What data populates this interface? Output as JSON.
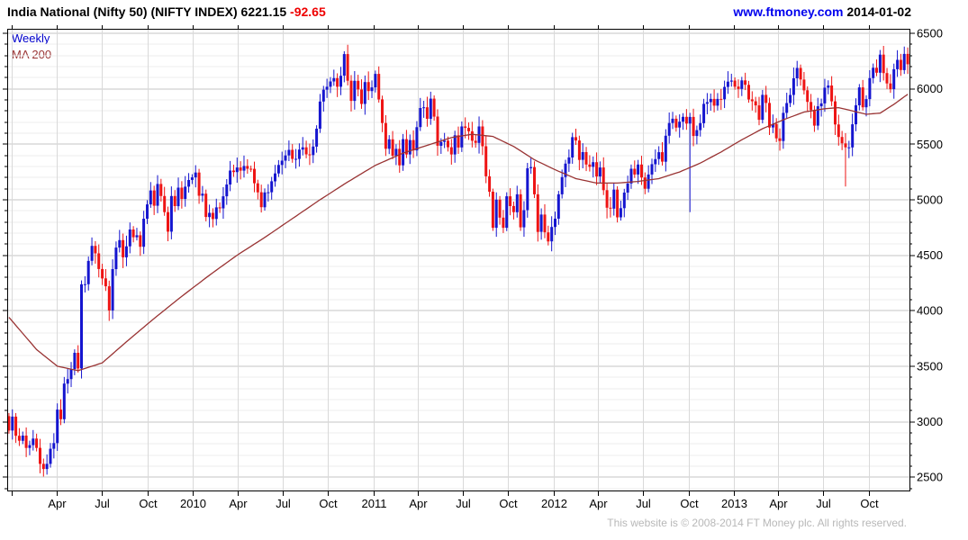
{
  "header": {
    "title": "India National (Nifty 50) (NIFTY INDEX) 6221.15",
    "change": "-92.65",
    "site": "www.ftmoney.com",
    "date": "2014-01-02"
  },
  "legend": {
    "series_label": "Weekly",
    "ma_label": "MA 200"
  },
  "footer": {
    "copyright": "This website is © 2008-2014 FT Money plc. All rights reserved."
  },
  "colors": {
    "up": "#1515cf",
    "down": "#ee1414",
    "ma": "#993333",
    "grid_minor": "#ececec",
    "grid_major": "#c6c6c6",
    "grid_vertical": "#d9d9d9",
    "axis": "#000000",
    "change_text": "#ee0000",
    "link": "#0000ee",
    "legend_series": "#0000cc",
    "legend_ma": "#993333",
    "footer_text": "#b8b8b8"
  },
  "chart_data": {
    "type": "candlestick",
    "title": "India National (Nifty 50) (NIFTY INDEX)",
    "timeframe": "Weekly",
    "overlay": "MA 200",
    "last_price": 6221.15,
    "change": -92.65,
    "date": "2014-01-02",
    "ylim": [
      2380,
      6540
    ],
    "y_ticks_labeled": [
      2500,
      3000,
      3500,
      4000,
      4500,
      5000,
      5500,
      6000,
      6500
    ],
    "y_minor_step": 100,
    "x_ticks": [
      {
        "week": 1.3,
        "label": ""
      },
      {
        "week": 14.4,
        "label": "Apr"
      },
      {
        "week": 27.4,
        "label": "Jul"
      },
      {
        "week": 40.6,
        "label": "Oct"
      },
      {
        "week": 53.7,
        "label": "2010"
      },
      {
        "week": 66.6,
        "label": "Apr"
      },
      {
        "week": 79.6,
        "label": "Jul"
      },
      {
        "week": 92.7,
        "label": "Oct"
      },
      {
        "week": 105.9,
        "label": "2011"
      },
      {
        "week": 118.7,
        "label": "Apr"
      },
      {
        "week": 131.7,
        "label": "Jul"
      },
      {
        "week": 144.9,
        "label": "Oct"
      },
      {
        "week": 158.0,
        "label": "2012"
      },
      {
        "week": 171.0,
        "label": "Apr"
      },
      {
        "week": 184.0,
        "label": "Jul"
      },
      {
        "week": 197.1,
        "label": "Oct"
      },
      {
        "week": 210.3,
        "label": "2013"
      },
      {
        "week": 223.1,
        "label": "Apr"
      },
      {
        "week": 236.1,
        "label": "Jul"
      },
      {
        "week": 249.3,
        "label": "Oct"
      }
    ],
    "start_open": 3050,
    "closes": [
      2920,
      3046,
      2873,
      2828,
      2875,
      2764,
      2789,
      2848,
      2764,
      2620,
      2574,
      2620,
      2756,
      2807,
      3109,
      3022,
      3343,
      3384,
      3474,
      3621,
      3480,
      4238,
      4239,
      4449,
      4584,
      4517,
      4376,
      4291,
      4220,
      4003,
      4375,
      4569,
      4636,
      4481,
      4580,
      4732,
      4662,
      4680,
      4576,
      4829,
      4958,
      5084,
      4946,
      5142,
      5033,
      4888,
      4712,
      5033,
      4942,
      5109,
      5008,
      5118,
      5178,
      5201,
      5245,
      5036,
      5054,
      4844,
      4882,
      4826,
      4931,
      4922,
      5031,
      5137,
      5263,
      5249,
      5290,
      5262,
      5304,
      5279,
      5278,
      5148,
      5067,
      4932,
      5066,
      5067,
      5166,
      5237,
      5313,
      5352,
      5399,
      5449,
      5367,
      5368,
      5452,
      5472,
      5409,
      5402,
      5479,
      5640,
      5885,
      5991,
      6018,
      6066,
      6096,
      6018,
      6117,
      6312,
      6072,
      5890,
      6071,
      5993,
      5863,
      6060,
      5979,
      6012,
      6134,
      5904,
      5691,
      5459,
      5544,
      5396,
      5458,
      5310,
      5546,
      5408,
      5538,
      5445,
      5654,
      5826,
      5833,
      5729,
      5911,
      5749,
      5486,
      5521,
      5532,
      5473,
      5408,
      5581,
      5471,
      5660,
      5647,
      5616,
      5531,
      5512,
      5660,
      5482,
      5211,
      5072,
      4747,
      5001,
      4839,
      4747,
      5031,
      4943,
      4888,
      5049,
      4751,
      4906,
      5284,
      5294,
      5049,
      4710,
      4866,
      4706,
      4624,
      4754,
      4829,
      5049,
      5204,
      5325,
      5381,
      5564,
      5534,
      5359,
      5429,
      5317,
      5296,
      5338,
      5209,
      5290,
      5086,
      4928,
      4920,
      5091,
      4841,
      4924,
      5064,
      5146,
      5279,
      5227,
      5317,
      5200,
      5099,
      5227,
      5320,
      5366,
      5428,
      5343,
      5577,
      5691,
      5730,
      5650,
      5703,
      5747,
      5686,
      5746,
      5574,
      5627,
      5690,
      5864,
      5879,
      5908,
      5847,
      5908,
      5905,
      6016,
      6064,
      6074,
      6019,
      5998,
      6075,
      6035,
      5904,
      5887,
      5850,
      5720,
      5945,
      5872,
      5651,
      5683,
      5553,
      5529,
      5783,
      5871,
      5944,
      6094,
      6187,
      6083,
      5986,
      5881,
      5808,
      5668,
      5842,
      5868,
      6009,
      6029,
      5886,
      5678,
      5565,
      5508,
      5472,
      5472,
      5680,
      5851,
      6012,
      5833,
      5907,
      6096,
      6189,
      6144,
      6307,
      6141,
      6048,
      5996,
      6176,
      6260,
      6168,
      6314,
      6221
    ],
    "wick_overrides": [
      {
        "index": 97,
        "high": 6338
      },
      {
        "index": 197,
        "low": 4888
      },
      {
        "index": 242,
        "low": 5119
      },
      {
        "index": 259,
        "high": 6380
      }
    ],
    "ma200": [
      [
        0,
        3940
      ],
      [
        8,
        3650
      ],
      [
        14,
        3500
      ],
      [
        20,
        3460
      ],
      [
        27,
        3530
      ],
      [
        34,
        3720
      ],
      [
        42,
        3930
      ],
      [
        50,
        4130
      ],
      [
        58,
        4320
      ],
      [
        66,
        4500
      ],
      [
        74,
        4660
      ],
      [
        82,
        4830
      ],
      [
        90,
        5000
      ],
      [
        98,
        5160
      ],
      [
        106,
        5310
      ],
      [
        114,
        5420
      ],
      [
        122,
        5500
      ],
      [
        128,
        5560
      ],
      [
        134,
        5590
      ],
      [
        140,
        5570
      ],
      [
        146,
        5480
      ],
      [
        152,
        5360
      ],
      [
        158,
        5270
      ],
      [
        164,
        5190
      ],
      [
        170,
        5150
      ],
      [
        176,
        5150
      ],
      [
        182,
        5165
      ],
      [
        188,
        5190
      ],
      [
        194,
        5250
      ],
      [
        200,
        5330
      ],
      [
        206,
        5430
      ],
      [
        212,
        5540
      ],
      [
        218,
        5640
      ],
      [
        224,
        5720
      ],
      [
        230,
        5790
      ],
      [
        236,
        5820
      ],
      [
        240,
        5830
      ],
      [
        244,
        5800
      ],
      [
        248,
        5770
      ],
      [
        252,
        5780
      ],
      [
        256,
        5860
      ],
      [
        260,
        5950
      ]
    ]
  }
}
